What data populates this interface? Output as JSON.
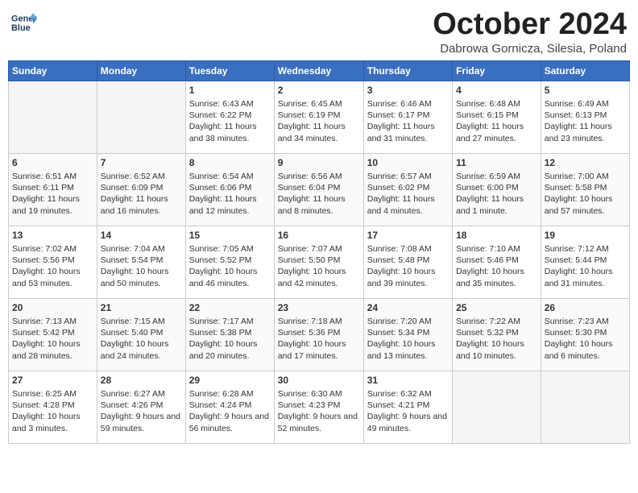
{
  "header": {
    "logo_line1": "General",
    "logo_line2": "Blue",
    "month": "October 2024",
    "location": "Dabrowa Gornicza, Silesia, Poland"
  },
  "weekdays": [
    "Sunday",
    "Monday",
    "Tuesday",
    "Wednesday",
    "Thursday",
    "Friday",
    "Saturday"
  ],
  "weeks": [
    [
      {
        "day": "",
        "empty": true
      },
      {
        "day": "",
        "empty": true
      },
      {
        "day": "1",
        "sunrise": "Sunrise: 6:43 AM",
        "sunset": "Sunset: 6:22 PM",
        "daylight": "Daylight: 11 hours and 38 minutes."
      },
      {
        "day": "2",
        "sunrise": "Sunrise: 6:45 AM",
        "sunset": "Sunset: 6:19 PM",
        "daylight": "Daylight: 11 hours and 34 minutes."
      },
      {
        "day": "3",
        "sunrise": "Sunrise: 6:46 AM",
        "sunset": "Sunset: 6:17 PM",
        "daylight": "Daylight: 11 hours and 31 minutes."
      },
      {
        "day": "4",
        "sunrise": "Sunrise: 6:48 AM",
        "sunset": "Sunset: 6:15 PM",
        "daylight": "Daylight: 11 hours and 27 minutes."
      },
      {
        "day": "5",
        "sunrise": "Sunrise: 6:49 AM",
        "sunset": "Sunset: 6:13 PM",
        "daylight": "Daylight: 11 hours and 23 minutes."
      }
    ],
    [
      {
        "day": "6",
        "sunrise": "Sunrise: 6:51 AM",
        "sunset": "Sunset: 6:11 PM",
        "daylight": "Daylight: 11 hours and 19 minutes."
      },
      {
        "day": "7",
        "sunrise": "Sunrise: 6:52 AM",
        "sunset": "Sunset: 6:09 PM",
        "daylight": "Daylight: 11 hours and 16 minutes."
      },
      {
        "day": "8",
        "sunrise": "Sunrise: 6:54 AM",
        "sunset": "Sunset: 6:06 PM",
        "daylight": "Daylight: 11 hours and 12 minutes."
      },
      {
        "day": "9",
        "sunrise": "Sunrise: 6:56 AM",
        "sunset": "Sunset: 6:04 PM",
        "daylight": "Daylight: 11 hours and 8 minutes."
      },
      {
        "day": "10",
        "sunrise": "Sunrise: 6:57 AM",
        "sunset": "Sunset: 6:02 PM",
        "daylight": "Daylight: 11 hours and 4 minutes."
      },
      {
        "day": "11",
        "sunrise": "Sunrise: 6:59 AM",
        "sunset": "Sunset: 6:00 PM",
        "daylight": "Daylight: 11 hours and 1 minute."
      },
      {
        "day": "12",
        "sunrise": "Sunrise: 7:00 AM",
        "sunset": "Sunset: 5:58 PM",
        "daylight": "Daylight: 10 hours and 57 minutes."
      }
    ],
    [
      {
        "day": "13",
        "sunrise": "Sunrise: 7:02 AM",
        "sunset": "Sunset: 5:56 PM",
        "daylight": "Daylight: 10 hours and 53 minutes."
      },
      {
        "day": "14",
        "sunrise": "Sunrise: 7:04 AM",
        "sunset": "Sunset: 5:54 PM",
        "daylight": "Daylight: 10 hours and 50 minutes."
      },
      {
        "day": "15",
        "sunrise": "Sunrise: 7:05 AM",
        "sunset": "Sunset: 5:52 PM",
        "daylight": "Daylight: 10 hours and 46 minutes."
      },
      {
        "day": "16",
        "sunrise": "Sunrise: 7:07 AM",
        "sunset": "Sunset: 5:50 PM",
        "daylight": "Daylight: 10 hours and 42 minutes."
      },
      {
        "day": "17",
        "sunrise": "Sunrise: 7:08 AM",
        "sunset": "Sunset: 5:48 PM",
        "daylight": "Daylight: 10 hours and 39 minutes."
      },
      {
        "day": "18",
        "sunrise": "Sunrise: 7:10 AM",
        "sunset": "Sunset: 5:46 PM",
        "daylight": "Daylight: 10 hours and 35 minutes."
      },
      {
        "day": "19",
        "sunrise": "Sunrise: 7:12 AM",
        "sunset": "Sunset: 5:44 PM",
        "daylight": "Daylight: 10 hours and 31 minutes."
      }
    ],
    [
      {
        "day": "20",
        "sunrise": "Sunrise: 7:13 AM",
        "sunset": "Sunset: 5:42 PM",
        "daylight": "Daylight: 10 hours and 28 minutes."
      },
      {
        "day": "21",
        "sunrise": "Sunrise: 7:15 AM",
        "sunset": "Sunset: 5:40 PM",
        "daylight": "Daylight: 10 hours and 24 minutes."
      },
      {
        "day": "22",
        "sunrise": "Sunrise: 7:17 AM",
        "sunset": "Sunset: 5:38 PM",
        "daylight": "Daylight: 10 hours and 20 minutes."
      },
      {
        "day": "23",
        "sunrise": "Sunrise: 7:18 AM",
        "sunset": "Sunset: 5:36 PM",
        "daylight": "Daylight: 10 hours and 17 minutes."
      },
      {
        "day": "24",
        "sunrise": "Sunrise: 7:20 AM",
        "sunset": "Sunset: 5:34 PM",
        "daylight": "Daylight: 10 hours and 13 minutes."
      },
      {
        "day": "25",
        "sunrise": "Sunrise: 7:22 AM",
        "sunset": "Sunset: 5:32 PM",
        "daylight": "Daylight: 10 hours and 10 minutes."
      },
      {
        "day": "26",
        "sunrise": "Sunrise: 7:23 AM",
        "sunset": "Sunset: 5:30 PM",
        "daylight": "Daylight: 10 hours and 6 minutes."
      }
    ],
    [
      {
        "day": "27",
        "sunrise": "Sunrise: 6:25 AM",
        "sunset": "Sunset: 4:28 PM",
        "daylight": "Daylight: 10 hours and 3 minutes."
      },
      {
        "day": "28",
        "sunrise": "Sunrise: 6:27 AM",
        "sunset": "Sunset: 4:26 PM",
        "daylight": "Daylight: 9 hours and 59 minutes."
      },
      {
        "day": "29",
        "sunrise": "Sunrise: 6:28 AM",
        "sunset": "Sunset: 4:24 PM",
        "daylight": "Daylight: 9 hours and 56 minutes."
      },
      {
        "day": "30",
        "sunrise": "Sunrise: 6:30 AM",
        "sunset": "Sunset: 4:23 PM",
        "daylight": "Daylight: 9 hours and 52 minutes."
      },
      {
        "day": "31",
        "sunrise": "Sunrise: 6:32 AM",
        "sunset": "Sunset: 4:21 PM",
        "daylight": "Daylight: 9 hours and 49 minutes."
      },
      {
        "day": "",
        "empty": true
      },
      {
        "day": "",
        "empty": true
      }
    ]
  ]
}
